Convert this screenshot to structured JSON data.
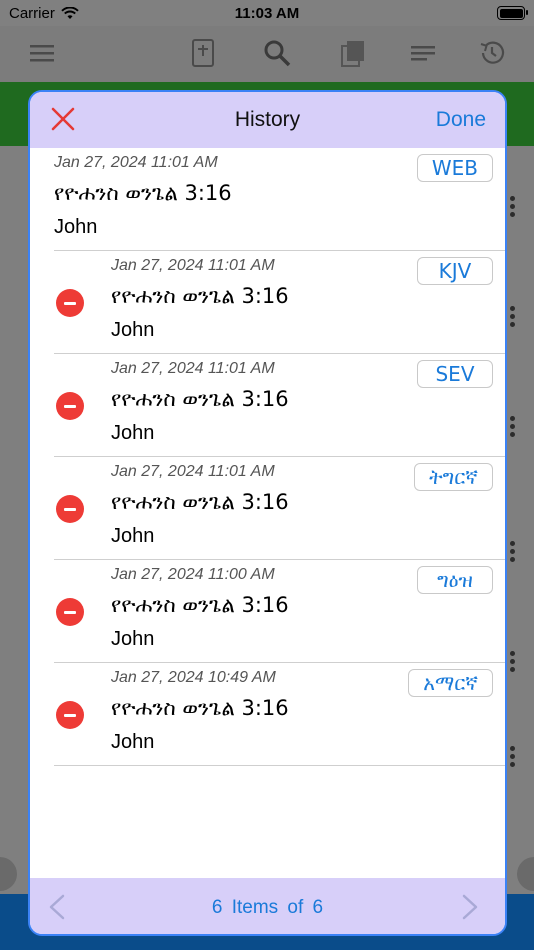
{
  "status_bar": {
    "carrier": "Carrier",
    "time": "11:03 AM"
  },
  "modal": {
    "title": "History",
    "done_label": "Done",
    "items": [
      {
        "date": "Jan 27, 2024 11:01 AM",
        "reference": "የዮሐንስ ወንጌል 3:16",
        "book": "John",
        "version": "WEB",
        "deletable": false
      },
      {
        "date": "Jan 27, 2024 11:01 AM",
        "reference": "የዮሐንስ ወንጌል 3:16",
        "book": "John",
        "version": "KJV",
        "deletable": true
      },
      {
        "date": "Jan 27, 2024 11:01 AM",
        "reference": "የዮሐንስ ወንጌል 3:16",
        "book": "John",
        "version": "SEV",
        "deletable": true
      },
      {
        "date": "Jan 27, 2024 11:01 AM",
        "reference": "የዮሐንስ ወንጌል 3:16",
        "book": "John",
        "version": "ትግርኛ",
        "deletable": true
      },
      {
        "date": "Jan 27, 2024 11:00 AM",
        "reference": "የዮሐንስ ወንጌል 3:16",
        "book": "John",
        "version": "ግዕዝ",
        "deletable": true
      },
      {
        "date": "Jan 27, 2024 10:49 AM",
        "reference": "የዮሐንስ ወንጌል 3:16",
        "book": "John",
        "version": "አማርኛ",
        "deletable": true
      }
    ],
    "footer": {
      "count_text": "6  Items  of  6"
    }
  },
  "colors": {
    "accent": "#1a7ad9",
    "header_bg": "#d7cff9",
    "delete": "#ee3b36",
    "close": "#e53935"
  },
  "icons": {
    "close": "close-x-icon",
    "delete": "minus-circle-icon",
    "prev": "chevron-left-icon",
    "next": "chevron-right-icon"
  }
}
